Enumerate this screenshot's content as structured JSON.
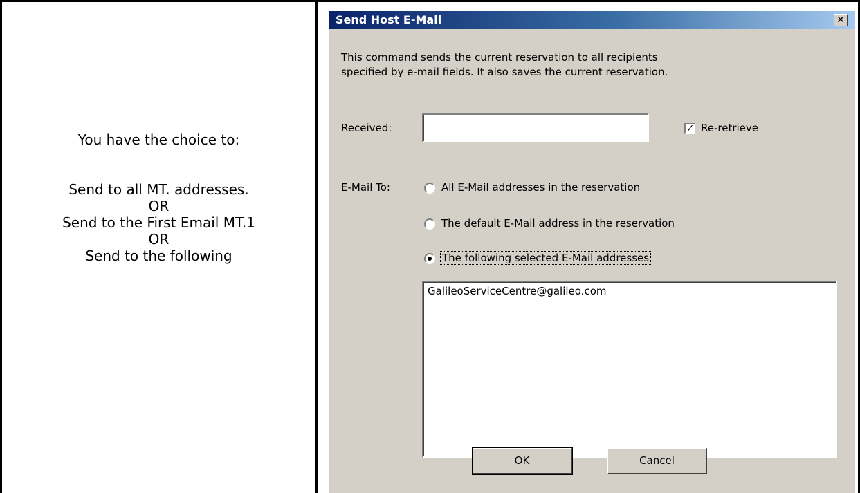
{
  "left_panel": {
    "heading": "You have the choice to:",
    "lines": [
      "Send to all MT. addresses.",
      "OR",
      "Send to the First Email MT.1",
      "OR",
      "Send to the following"
    ]
  },
  "dialog": {
    "title": "Send Host E-Mail",
    "close_glyph": "✕",
    "description_line1": "This command sends the current reservation to all recipients",
    "description_line2": "specified by e-mail fields.  It also saves the current reservation.",
    "received_label": "Received:",
    "received_value": "",
    "reretrieve_label": "Re-retrieve",
    "reretrieve_checked": true,
    "email_to_label": "E-Mail To:",
    "options": [
      {
        "label": "All E-Mail addresses in the reservation",
        "selected": false
      },
      {
        "label": "The default E-Mail address in the reservation",
        "selected": false
      },
      {
        "label": "The following selected E-Mail addresses",
        "selected": true
      }
    ],
    "addresses": [
      "GalileoServiceCentre@galileo.com"
    ],
    "ok_label": "OK",
    "cancel_label": "Cancel"
  },
  "colors": {
    "title_start": "#0a246a",
    "title_end": "#a6caf0",
    "dialog_bg": "#d4d0c8"
  }
}
